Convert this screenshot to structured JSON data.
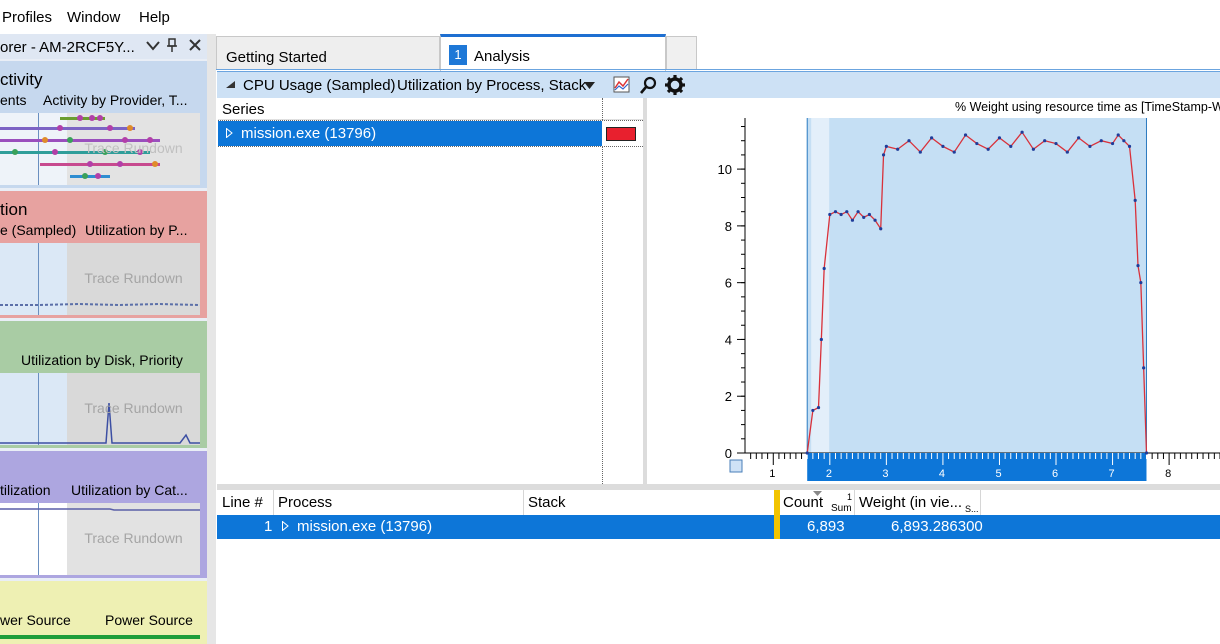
{
  "menu": [
    "Profiles",
    "Window",
    "Help"
  ],
  "explorer": {
    "title": "orer - AM-2RCF5Y...",
    "cards": [
      {
        "title": "ctivity",
        "sub_left": "ents",
        "sub_right": "Activity by Provider, T...",
        "rundown": "Trace Rundown",
        "color": "#c6d8ee"
      },
      {
        "title": "tion",
        "sub_left": "e (Sampled)",
        "sub_right": "Utilization by P...",
        "rundown": "Trace Rundown",
        "color": "#e7a2a0"
      },
      {
        "title": "",
        "sub_left": "",
        "sub_right": "Utilization by Disk, Priority",
        "rundown": "Trace Rundown",
        "color": "#a9cca4"
      },
      {
        "title": "",
        "sub_left": "tilization",
        "sub_right": "Utilization by Cat...",
        "rundown": "Trace Rundown",
        "color": "#ada6e0"
      },
      {
        "title": "",
        "sub_left": "wer Source",
        "sub_right": "Power Source",
        "rundown": "",
        "color": "#eef0b3"
      }
    ]
  },
  "tabs": [
    {
      "label": "Getting Started"
    },
    {
      "number": "1",
      "label": "Analysis"
    }
  ],
  "graph_header": {
    "graph_name": "CPU Usage (Sampled)",
    "preset": "Utilization by Process, Stack"
  },
  "series_panel": {
    "header": "Series",
    "row_label": "mission.exe (13796)",
    "swatch_color": "#e8202e"
  },
  "chart_data": {
    "type": "line",
    "title": "% Weight using resource time as [TimeStamp-W",
    "x": [
      1.6,
      1.7,
      1.8,
      1.85,
      1.9,
      2.0,
      2.1,
      2.2,
      2.3,
      2.4,
      2.5,
      2.6,
      2.7,
      2.8,
      2.9,
      2.95,
      3.0,
      3.2,
      3.4,
      3.6,
      3.8,
      4.0,
      4.2,
      4.4,
      4.6,
      4.8,
      5.0,
      5.2,
      5.4,
      5.6,
      5.8,
      6.0,
      6.2,
      6.4,
      6.6,
      6.8,
      7.0,
      7.1,
      7.2,
      7.3,
      7.4,
      7.45,
      7.5,
      7.55,
      7.6
    ],
    "y": [
      0,
      1.5,
      1.6,
      4.0,
      6.5,
      8.4,
      8.5,
      8.4,
      8.5,
      8.2,
      8.5,
      8.3,
      8.4,
      8.2,
      7.9,
      10.5,
      10.8,
      10.7,
      11.0,
      10.6,
      11.1,
      10.8,
      10.6,
      11.2,
      10.9,
      10.7,
      11.1,
      10.8,
      11.3,
      10.7,
      11.0,
      10.9,
      10.6,
      11.1,
      10.8,
      11.0,
      10.9,
      11.2,
      11.0,
      10.8,
      8.9,
      6.6,
      6.0,
      3.0,
      0
    ],
    "ylim": [
      0,
      11.8
    ],
    "xlim": [
      0.5,
      8.9
    ],
    "yticks": [
      "0",
      "2",
      "4",
      "6",
      "8",
      "10"
    ],
    "xticks": [
      "1",
      "2",
      "3",
      "4",
      "5",
      "6",
      "7",
      "8"
    ],
    "selection_range": [
      1.6,
      7.6
    ],
    "line_color": "#d9313a",
    "marker_color": "#1f3c99"
  },
  "table": {
    "columns": [
      "Line #",
      "Process",
      "Stack",
      "Count",
      "Weight (in vie..."
    ],
    "count_sub": "Sum",
    "sort_marker": "1",
    "weight_sub": "S...",
    "rows": [
      {
        "line": "1",
        "process": "mission.exe (13796)",
        "stack": "",
        "count": "6,893",
        "weight": "6,893.286300"
      }
    ]
  }
}
